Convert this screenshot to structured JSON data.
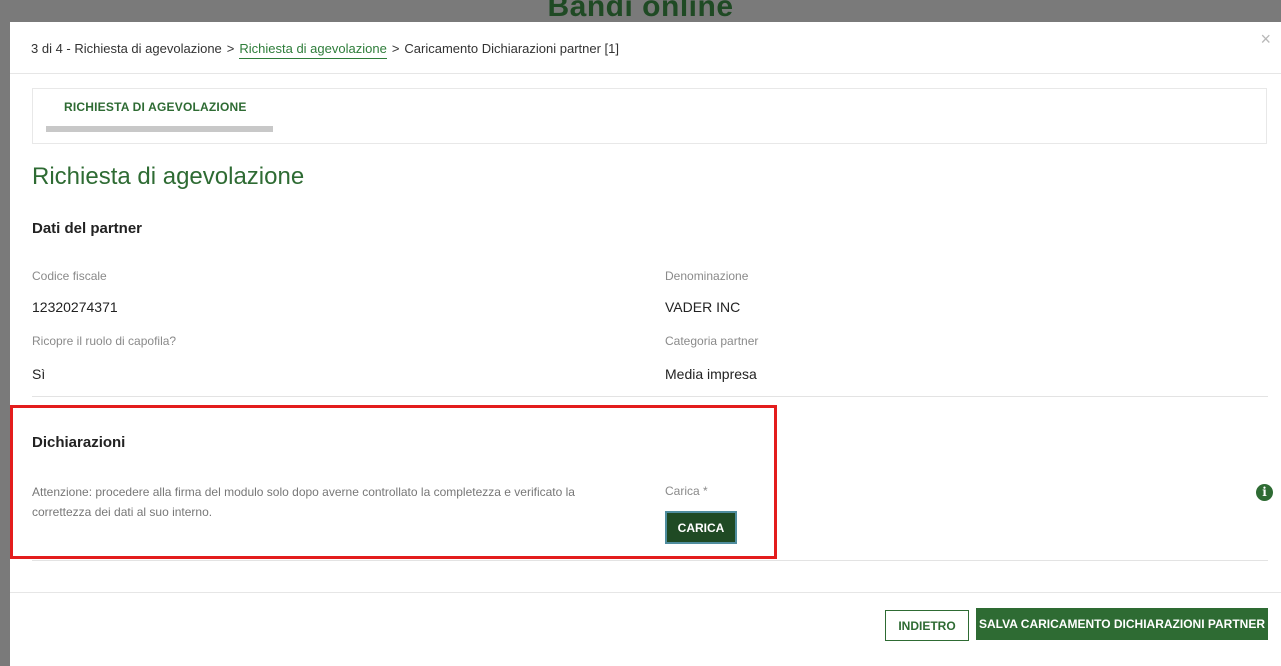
{
  "background": {
    "title": "Bandi online"
  },
  "modal": {
    "close_symbol": "×"
  },
  "breadcrumb": {
    "step": "3 di 4 - Richiesta di agevolazione",
    "separator": ">",
    "link": "Richiesta di agevolazione",
    "current": "Caricamento Dichiarazioni partner [1]"
  },
  "tabs": [
    {
      "label": "RICHIESTA DI AGEVOLAZIONE"
    }
  ],
  "page": {
    "title": "Richiesta di agevolazione"
  },
  "partner": {
    "section_title": "Dati del partner",
    "fields": [
      {
        "label": "Codice fiscale",
        "value": "12320274371"
      },
      {
        "label": "Denominazione",
        "value": "VADER INC"
      },
      {
        "label": "Ricopre il ruolo di capofila?",
        "value": "Sì"
      },
      {
        "label": "Categoria partner",
        "value": "Media impresa"
      }
    ]
  },
  "dichiarazioni": {
    "section_title": "Dichiarazioni",
    "note": "Attenzione: procedere alla firma del modulo solo dopo averne controllato la completezza e verificato la correttezza dei dati al suo interno.",
    "upload_label": "Carica *",
    "upload_button": "CARICA",
    "info_icon": "info-icon"
  },
  "footer": {
    "back_label": "INDIETRO",
    "save_label": "SALVA CARICAMENTO DICHIARAZIONI PARTNER"
  },
  "colors": {
    "accent": "#2e6b33",
    "dark_button": "#1f4a24",
    "highlight": "#e31d1d"
  }
}
